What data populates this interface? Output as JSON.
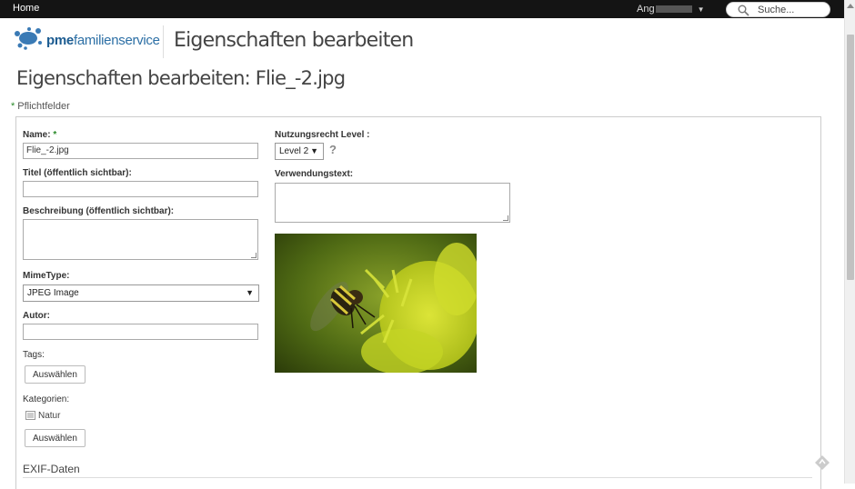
{
  "topbar": {
    "home": "Home",
    "user": "Ang",
    "search_placeholder": "Suche..."
  },
  "header": {
    "logo_prefix": "pme",
    "logo_suffix": "familienservice",
    "title": "Eigenschaften bearbeiten"
  },
  "page": {
    "title": "Eigenschaften bearbeiten: Flie_-2.jpg",
    "required_star": "*",
    "required_note": "Pflichtfelder"
  },
  "form": {
    "name_label": "Name:",
    "name_req": "*",
    "name_value": "Flie_-2.jpg",
    "titel_label": "Titel (öffentlich sichtbar):",
    "titel_value": "",
    "beschreibung_label": "Beschreibung (öffentlich sichtbar):",
    "mimetype_label": "MimeType:",
    "mimetype_value": "JPEG Image",
    "autor_label": "Autor:",
    "autor_value": "",
    "tags_label": "Tags:",
    "tags_button": "Auswählen",
    "kategorien_label": "Kategorien:",
    "kategorie_item": "Natur",
    "kategorien_button": "Auswählen",
    "nutzungsrecht_label": "Nutzungsrecht Level :",
    "nutzungsrecht_value": "Level 2",
    "help": "?",
    "verwendungstext_label": "Verwendungstext:",
    "exif_heading": "EXIF-Daten"
  },
  "colors": {
    "topbar": "#141414",
    "accent_green": "#2a8a2a",
    "logo_blue": "#2c6fa5"
  },
  "icons": [
    "search-icon",
    "caret-down-icon",
    "logo-splash-icon",
    "document-icon",
    "select-arrow-icon",
    "corner-badge-icon"
  ]
}
